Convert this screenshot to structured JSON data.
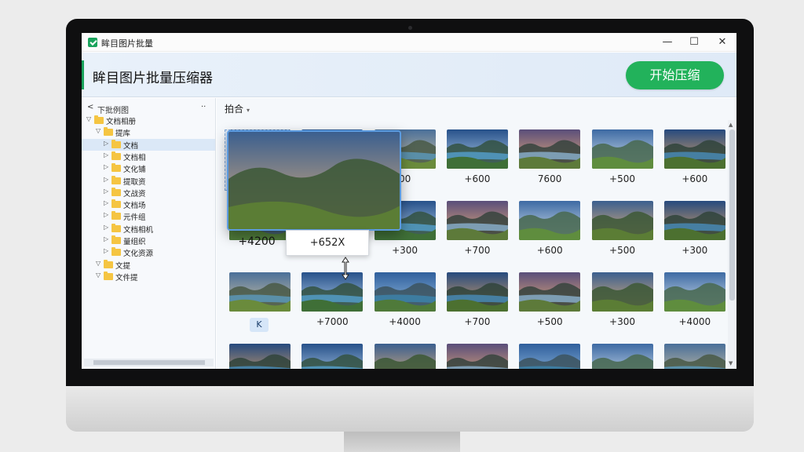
{
  "window": {
    "title": "眸目图片批量",
    "minimize": "—",
    "maximize": "☐",
    "close": "✕"
  },
  "header": {
    "title": "眸目图片批量压缩器",
    "start_button": "开始压缩"
  },
  "sidebar": {
    "back": "<",
    "head_label": "下批例图",
    "collapse": "··",
    "tree": [
      {
        "arrow": "▽",
        "label": "文档相册",
        "indent": 0,
        "selected": false
      },
      {
        "arrow": "▽",
        "label": "提库",
        "indent": 1,
        "selected": false
      },
      {
        "arrow": "▷",
        "label": "文档",
        "indent": 2,
        "selected": true
      },
      {
        "arrow": "▷",
        "label": "文档相",
        "indent": 2,
        "selected": false
      },
      {
        "arrow": "▷",
        "label": "文化铺",
        "indent": 2,
        "selected": false
      },
      {
        "arrow": "▷",
        "label": "提取资",
        "indent": 2,
        "selected": false
      },
      {
        "arrow": "▷",
        "label": "文战资",
        "indent": 2,
        "selected": false
      },
      {
        "arrow": "▷",
        "label": "文档场",
        "indent": 2,
        "selected": false
      },
      {
        "arrow": "▷",
        "label": "元件组",
        "indent": 2,
        "selected": false
      },
      {
        "arrow": "▷",
        "label": "文档相机",
        "indent": 2,
        "selected": false
      },
      {
        "arrow": "▷",
        "label": "量组织",
        "indent": 2,
        "selected": false
      },
      {
        "arrow": "▷",
        "label": "文化资源",
        "indent": 2,
        "selected": false
      },
      {
        "arrow": "▽",
        "label": "文提",
        "indent": 1,
        "selected": false
      },
      {
        "arrow": "▽",
        "label": "文件提",
        "indent": 1,
        "selected": false
      }
    ]
  },
  "main": {
    "sort_label": "拍合",
    "sort_caret": "▾",
    "preview_label": "+4200",
    "tooltip": "+652X",
    "badge": "K",
    "thumbnails": [
      {
        "label": "",
        "scene": 0
      },
      {
        "label": "",
        "scene": 1
      },
      {
        "label": "00",
        "scene": 2
      },
      {
        "label": "+600",
        "scene": 3
      },
      {
        "label": "7600",
        "scene": 4
      },
      {
        "label": "+500",
        "scene": 5
      },
      {
        "label": "+600",
        "scene": 6
      },
      {
        "label": "",
        "scene": 1
      },
      {
        "label": "",
        "scene": 2
      },
      {
        "label": "+300",
        "scene": 3
      },
      {
        "label": "+700",
        "scene": 4
      },
      {
        "label": "+600",
        "scene": 5
      },
      {
        "label": "+500",
        "scene": 0
      },
      {
        "label": "+300",
        "scene": 6
      },
      {
        "label": "",
        "scene": 2
      },
      {
        "label": "+7000",
        "scene": 3
      },
      {
        "label": "+4000",
        "scene": 1
      },
      {
        "label": "+700",
        "scene": 6
      },
      {
        "label": "+500",
        "scene": 4
      },
      {
        "label": "+300",
        "scene": 0
      },
      {
        "label": "+4000",
        "scene": 5
      },
      {
        "label": "",
        "scene": 6
      },
      {
        "label": "",
        "scene": 3
      },
      {
        "label": "",
        "scene": 0
      },
      {
        "label": "",
        "scene": 4
      },
      {
        "label": "",
        "scene": 1
      },
      {
        "label": "",
        "scene": 5
      },
      {
        "label": "",
        "scene": 2
      }
    ]
  },
  "colors": {
    "accent_green": "#22b25b",
    "selection_blue": "#5b9be0"
  }
}
